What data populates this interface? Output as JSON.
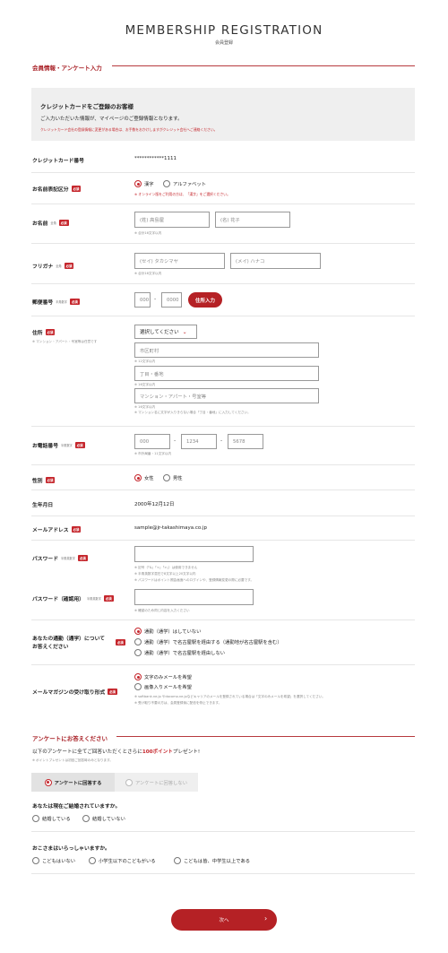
{
  "header": {
    "title": "MEMBERSHIP REGISTRATION",
    "subtitle": "会員登録"
  },
  "section1": {
    "title": "会員情報・アンケート入力"
  },
  "notice": {
    "title": "クレジットカードをご登録のお客様",
    "body": "ご入力いただいた情報が、マイページのご登録情報となります。",
    "warning": "クレジットカード会社の登録情報に変更がある場合は、お手数をおかけしますがクレジット会社へご連絡ください。"
  },
  "labels": {
    "required": "必須",
    "zenkaku": "全角",
    "hankaku_num": "半角数字",
    "hankaku_eisu": "半角英数字"
  },
  "card": {
    "label": "クレジットカード番号",
    "value": "************1111"
  },
  "name_type": {
    "label": "お名前表記区分",
    "options": [
      "漢字",
      "アルファベット"
    ],
    "note": "※ オンライン版をご利用の方は、「漢字」をご選択ください。"
  },
  "name": {
    "label": "お名前",
    "last": "(姓) 高島屋",
    "first": "(名) 花子",
    "hint": "※ 合計16文字以内"
  },
  "kana": {
    "label": "フリガナ",
    "last": "(セイ) タカシマヤ",
    "first": "(メイ) ハナコ",
    "hint": "※ 合計16文字以内"
  },
  "postal": {
    "label": "郵便番号",
    "p1": "000",
    "p2": "0000",
    "button": "住所入力"
  },
  "address": {
    "label": "住所",
    "sublabel": "※ マンション・アパート・号室等は任意です",
    "prefecture": "選択してください",
    "city": "市区町村",
    "city_hint": "※ 12文字以内",
    "street": "丁目・番地",
    "street_hint": "※ 16文字以内",
    "building": "マンション・アパート・号室等",
    "building_hint1": "※ 16文字以内",
    "building_hint2": "※ マンション名に文字が入りきらない場合「丁目・番地」に入力してください。"
  },
  "phone": {
    "label": "お電話番号",
    "p1": "000",
    "p2": "1234",
    "p3": "5678",
    "hint": "※ 市外局番・11文字以内"
  },
  "gender": {
    "label": "性別",
    "options": [
      "女性",
      "男性"
    ]
  },
  "birthday": {
    "label": "生年月日",
    "value": "2000年12月12日"
  },
  "email": {
    "label": "メールアドレス",
    "value": "sample@jr-takashimaya.co.jp"
  },
  "password": {
    "label": "パスワード",
    "hint1": "※ 記号（「&」「<」「>」）は使用できません",
    "hint2": "※ 半角英数字混在で8文字以上20文字以内",
    "hint3": "※ パスワードはポイント照会画面へのログインや、登録情報変更の際に必要です。"
  },
  "password_confirm": {
    "label": "パスワード（確認用）",
    "hint": "※ 確認のため同じ内容を入力ください"
  },
  "commute": {
    "label_line1": "あなたの通勤（通学）について",
    "label_line2": "お答えください",
    "options": [
      "通勤（通学）はしていない",
      "通勤（通学）で名古屋駅を経由する（通勤地が名古屋駅を含む）",
      "通勤（通学）で名古屋駅を経由しない"
    ]
  },
  "newsletter": {
    "label": "メールマガジンの受け取り形式",
    "options": [
      "文字のみメールを希望",
      "画像入りメールを希望"
    ],
    "hint1": "※ softbank.ne.jp やdocomo.ne.jpなどキャリアのメールを登録されている場合は「文字のみメールを希望」を選択してください。",
    "hint2": "※ 受け取り不要の方は、会員登録後に配信を停止できます。"
  },
  "survey": {
    "title": "アンケートにお答えください",
    "intro_before": "以下のアンケートに全てご回答いただくとさらに",
    "intro_points": "100ポイント",
    "intro_after": "プレゼント!",
    "note": "※ ポイントプレゼントは初回ご回答時のみとなります。",
    "tab_answer": "アンケートに回答する",
    "tab_skip": "アンケートに回答しない",
    "q1": "あなたは現在ご結婚されていますか。",
    "q1_options": [
      "結婚している",
      "結婚していない"
    ],
    "q2": "おこさまはいらっしゃいますか。",
    "q2_options": [
      "こどもはいない",
      "小学生以下のこどもがいる",
      "こどもは皆、中学生以上である"
    ]
  },
  "next_button": {
    "label": "次へ",
    "arrow": "›"
  },
  "colors": {
    "accent": "#b52125",
    "panel": "#efefef"
  }
}
